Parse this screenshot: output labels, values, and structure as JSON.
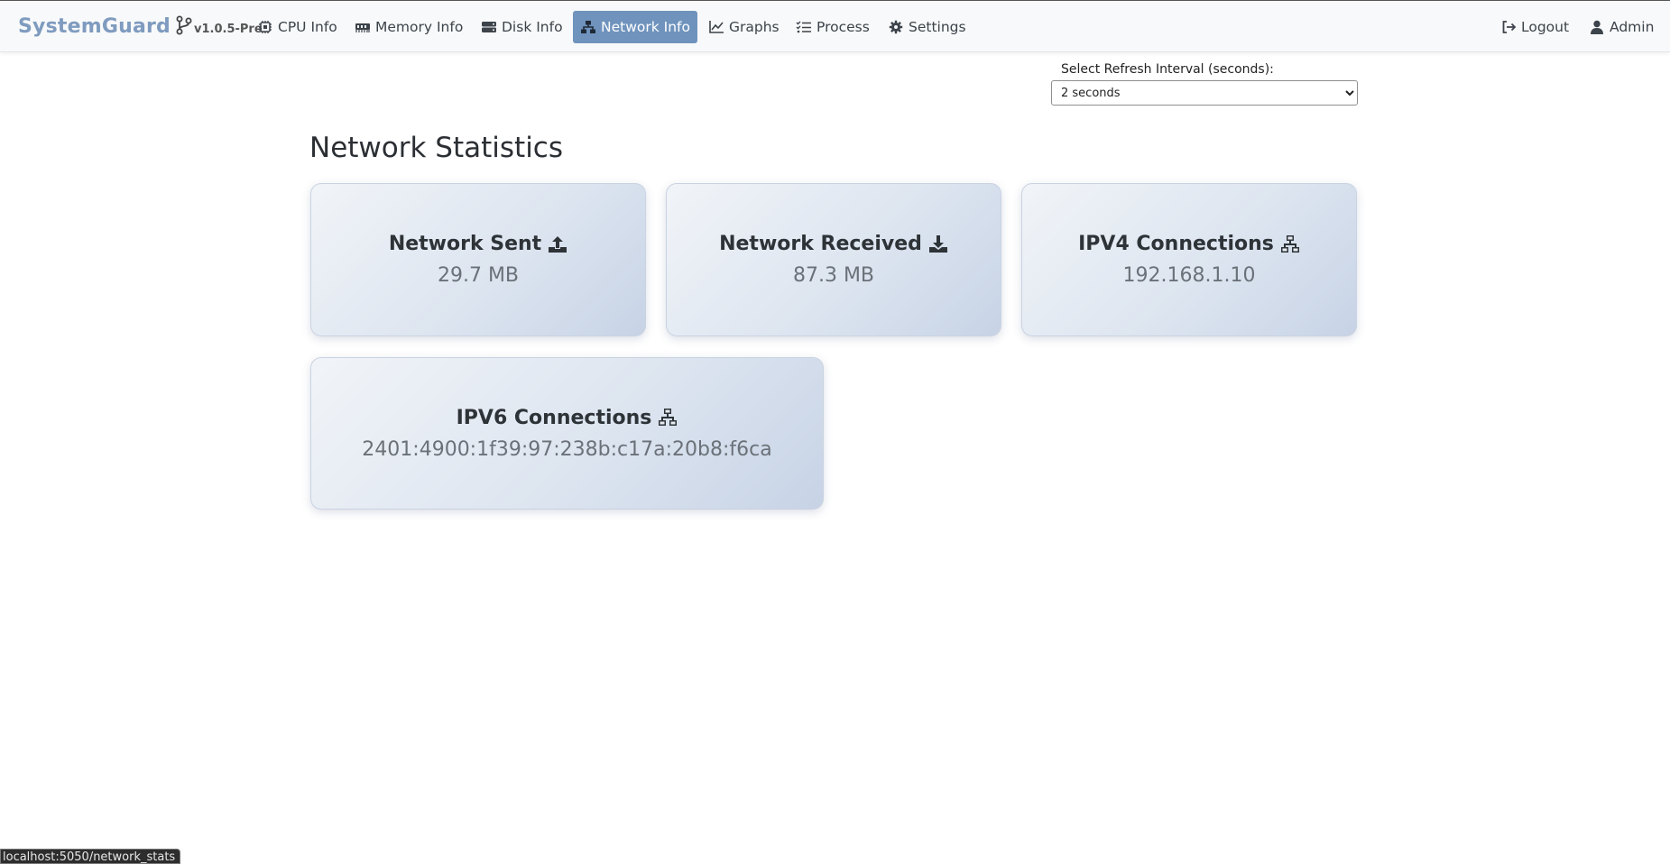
{
  "brand": {
    "name": "SystemGuard",
    "version": "v1.0.5-Pre"
  },
  "nav": {
    "items": [
      {
        "label": "CPU Info",
        "icon": "cpu-icon"
      },
      {
        "label": "Memory Info",
        "icon": "memory-icon"
      },
      {
        "label": "Disk Info",
        "icon": "disk-icon"
      },
      {
        "label": "Network Info",
        "icon": "network-icon",
        "active": true
      },
      {
        "label": "Graphs",
        "icon": "chart-line-icon"
      },
      {
        "label": "Process",
        "icon": "tasks-icon"
      },
      {
        "label": "Settings",
        "icon": "gear-icon"
      }
    ],
    "logout": "Logout",
    "user": "Admin"
  },
  "refresh": {
    "label": "Select Refresh Interval (seconds):",
    "selected": "2 seconds"
  },
  "page_title": "Network Statistics",
  "cards": [
    {
      "title": "Network Sent",
      "value": "29.7 MB",
      "icon": "upload-icon"
    },
    {
      "title": "Network Received",
      "value": "87.3 MB",
      "icon": "download-icon"
    },
    {
      "title": "IPV4 Connections",
      "value": "192.168.1.10",
      "icon": "network-wired-icon"
    },
    {
      "title": "IPV6 Connections",
      "value": "2401:4900:1f39:97:238b:c17a:20b8:f6ca",
      "icon": "network-wired-icon"
    }
  ],
  "status_bar": {
    "url": "localhost:5050/network_stats"
  },
  "colors": {
    "brand": "#7f9bbf",
    "active_nav": "#6f93bd",
    "card_gradient_end": "#c7d3e6"
  }
}
